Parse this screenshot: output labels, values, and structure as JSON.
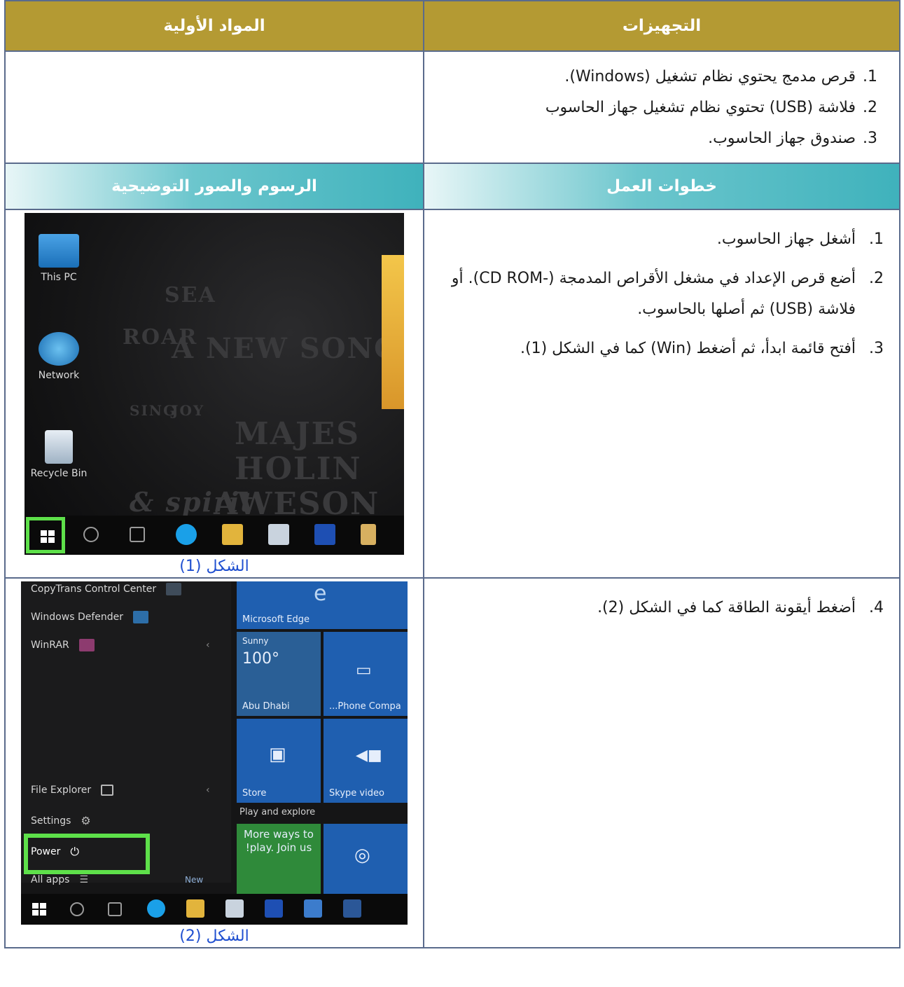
{
  "headers": {
    "equipment": "التجهيزات",
    "materials": "المواد الأولية",
    "steps": "خطوات العمل",
    "illustrations": "الرسوم والصور التوضيحية"
  },
  "equipment_items": [
    {
      "num": "1.",
      "text": "قرص مدمج يحتوي نظام تشغيل (Windows)."
    },
    {
      "num": "2.",
      "text": "فلاشة (USB) تحتوي نظام تشغيل جهاز الحاسوب"
    },
    {
      "num": "3.",
      "text": "صندوق جهاز الحاسوب."
    }
  ],
  "steps": [
    {
      "num": "1.",
      "text": "أشغل جهاز الحاسوب."
    },
    {
      "num": "2.",
      "text": "أضع قرص الإعداد في مشغل الأقراص المدمجة (-CD ROM). أو فلاشة (USB) ثم أصلها بالحاسوب."
    },
    {
      "num": "3.",
      "text": "أفتح قائمة ابدأ، ثم أضغط (Win) كما في الشكل (1)."
    },
    {
      "num": "4.",
      "text": "أضغط أيقونة الطاقة كما في الشكل (2)."
    }
  ],
  "figure1": {
    "caption": "الشكل (1)",
    "desktop_icons": [
      "This PC",
      "Network",
      "Recycle Bin"
    ],
    "background_words": [
      "A NEW SONG",
      "ROAR",
      "SEA",
      "MAJES",
      "HOLIN",
      "AWESON",
      "spirit &",
      "SING",
      "JOY"
    ],
    "taskbar_icons": [
      "start-icon",
      "search-icon",
      "task-view-icon",
      "skype-icon",
      "file-explorer-icon",
      "photos-icon",
      "photoshop-icon",
      "app-icon"
    ]
  },
  "figure2": {
    "caption": "الشكل (2)",
    "left_items": [
      "CopyTrans Control Center",
      "Windows Defender",
      "WinRAR",
      "File Explorer",
      "Settings",
      "Power",
      "All apps"
    ],
    "new_label": "New",
    "tiles": [
      {
        "label": "Microsoft Edge"
      },
      {
        "top": "Sunny",
        "big": "100°",
        "label": "Abu Dhabi"
      },
      {
        "label": "Phone Compa..."
      },
      {
        "label": "Store"
      },
      {
        "label": "Skype video"
      },
      {
        "label": "More ways to play. Join us!"
      }
    ],
    "section_label": "Play and explore"
  },
  "colors": {
    "header_gold": "#b49a33",
    "header_teal": "#3fb2bc",
    "caption_blue": "#1f4fd0",
    "highlight_green": "#5ee04a"
  }
}
